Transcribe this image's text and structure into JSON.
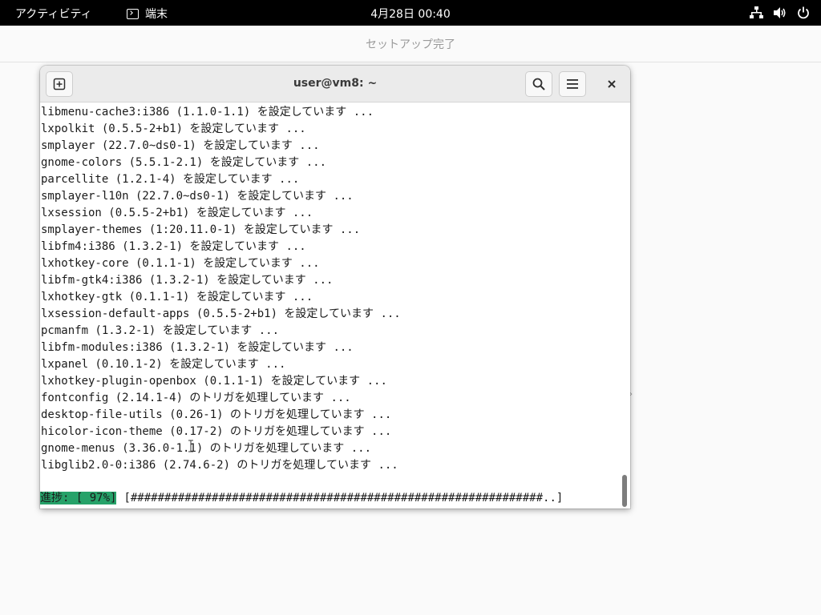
{
  "topbar": {
    "activities": "アクティビティ",
    "app_name": "端末",
    "clock": "4月28日  00:40",
    "tray_icons": [
      "network-icon",
      "volume-icon",
      "power-icon"
    ]
  },
  "background_app": {
    "title": "セットアップ完了"
  },
  "terminal": {
    "title": "user@vm8: ~",
    "lines": [
      "libmenu-cache3:i386 (1.1.0-1.1) を設定しています ...",
      "lxpolkit (0.5.5-2+b1) を設定しています ...",
      "smplayer (22.7.0~ds0-1) を設定しています ...",
      "gnome-colors (5.5.1-2.1) を設定しています ...",
      "parcellite (1.2.1-4) を設定しています ...",
      "smplayer-l10n (22.7.0~ds0-1) を設定しています ...",
      "lxsession (0.5.5-2+b1) を設定しています ...",
      "smplayer-themes (1:20.11.0-1) を設定しています ...",
      "libfm4:i386 (1.3.2-1) を設定しています ...",
      "lxhotkey-core (0.1.1-1) を設定しています ...",
      "libfm-gtk4:i386 (1.3.2-1) を設定しています ...",
      "lxhotkey-gtk (0.1.1-1) を設定しています ...",
      "lxsession-default-apps (0.5.5-2+b1) を設定しています ...",
      "pcmanfm (1.3.2-1) を設定しています ...",
      "libfm-modules:i386 (1.3.2-1) を設定しています ...",
      "lxpanel (0.10.1-2) を設定しています ...",
      "lxhotkey-plugin-openbox (0.1.1-1) を設定しています ...",
      "fontconfig (2.14.1-4) のトリガを処理しています ...",
      "desktop-file-utils (0.26-1) のトリガを処理しています ...",
      "hicolor-icon-theme (0.17-2) のトリガを処理しています ...",
      "gnome-menus (3.36.0-1.1) のトリガを処理しています ...",
      "libglib2.0-0:i386 (2.74.6-2) のトリガを処理しています ..."
    ],
    "progress": {
      "label": "進捗: [ 97%]",
      "bar": "[#############################################################..]",
      "percent": 97
    }
  },
  "colors": {
    "topbar_bg": "#000000",
    "progress_highlight": "#26a269",
    "headerbar_bg": "#ebebeb"
  }
}
